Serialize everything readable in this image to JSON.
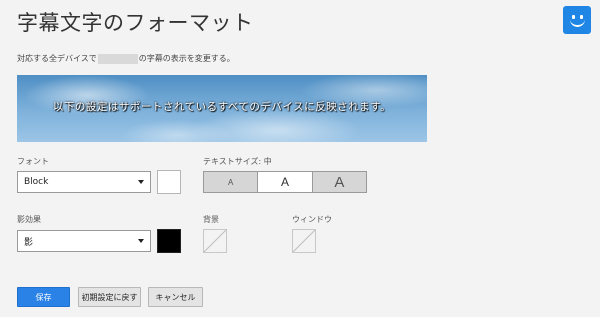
{
  "page": {
    "title": "字幕文字のフォーマット",
    "description_before": "対応する全デバイスで",
    "description_after": "の字幕の表示を変更する。"
  },
  "preview": {
    "text": "以下の設定はサポートされているすべてのデバイスに反映されます。"
  },
  "font": {
    "label": "フォント",
    "selected": "Block",
    "color": "#ffffff"
  },
  "text_size": {
    "label": "テキストサイズ: 中",
    "options": [
      "A",
      "A",
      "A"
    ],
    "selected_index": 1
  },
  "shadow": {
    "label": "影効果",
    "selected": "影",
    "color": "#000000"
  },
  "background": {
    "label": "背景"
  },
  "window": {
    "label": "ウィンドウ"
  },
  "buttons": {
    "save": "保存",
    "reset": "初期設定に戻す",
    "cancel": "キャンセル"
  },
  "colors": {
    "accent": "#2b82e6",
    "logo": "#1f86e6"
  }
}
